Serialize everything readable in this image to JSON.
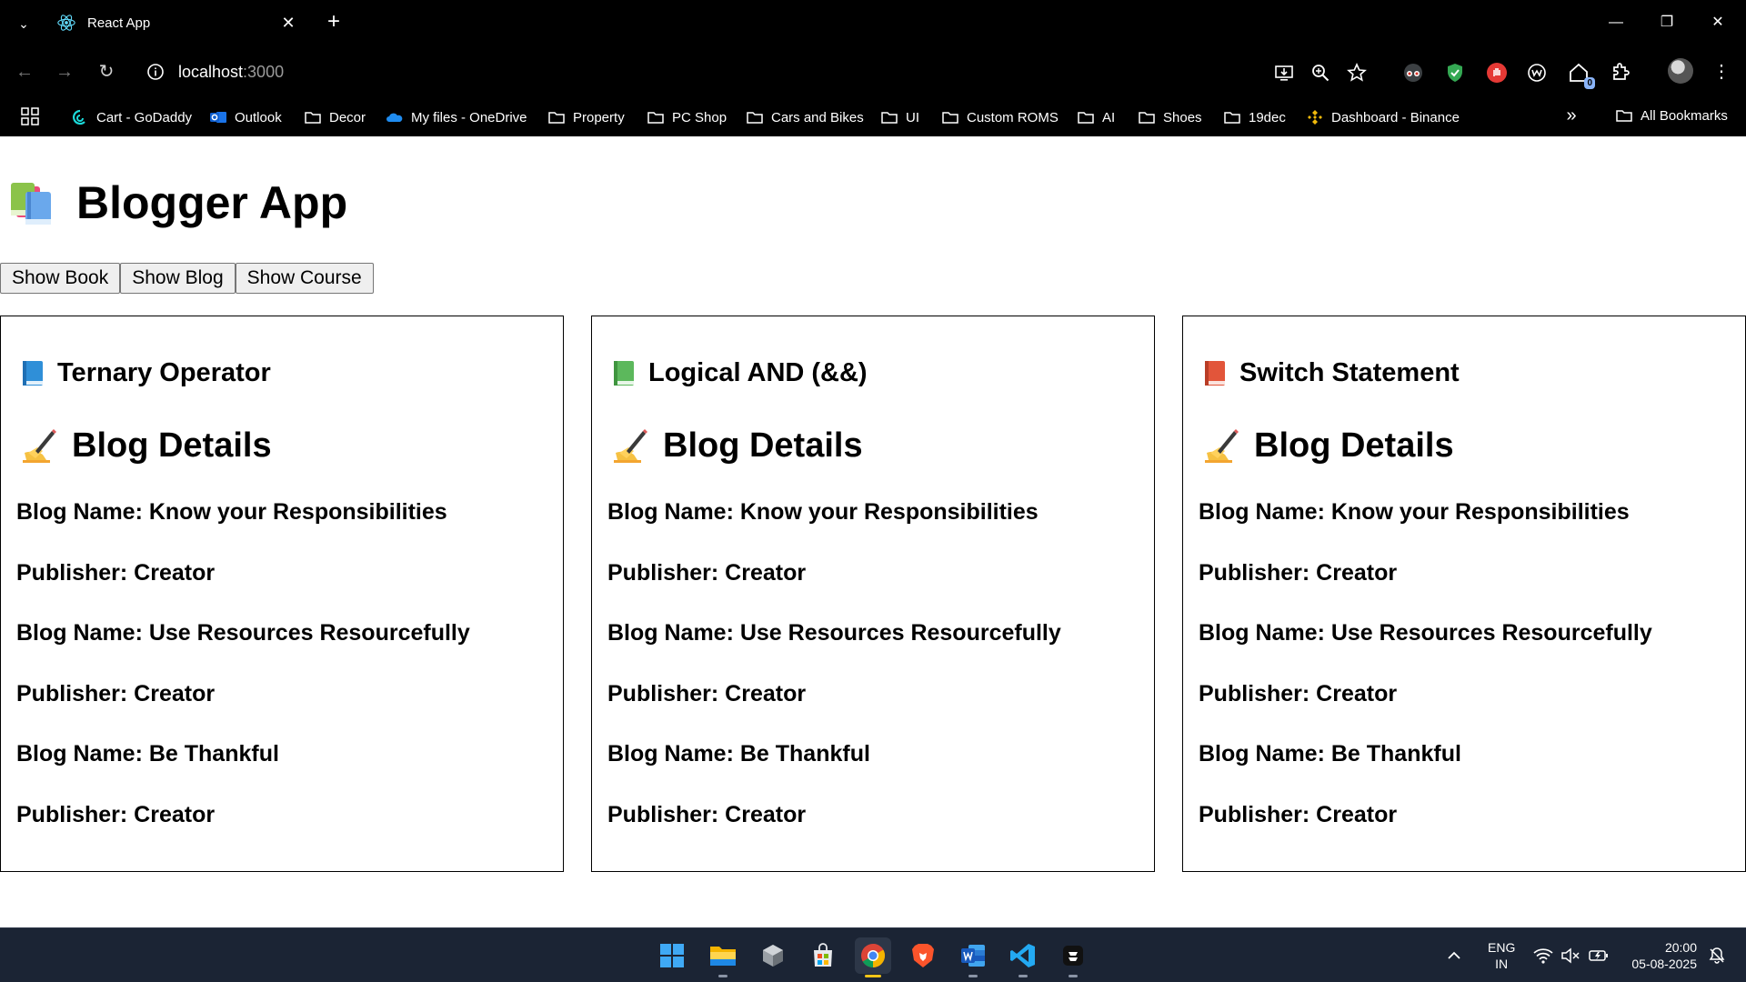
{
  "browser": {
    "tab_title": "React App",
    "url_host": "localhost",
    "url_port": ":3000",
    "extension_badge": "0"
  },
  "bookmarks": [
    {
      "label": "Cart - GoDaddy",
      "icon": "godaddy-icon"
    },
    {
      "label": "Outlook",
      "icon": "outlook-icon"
    },
    {
      "label": "Decor",
      "icon": "folder-icon"
    },
    {
      "label": "My files - OneDrive",
      "icon": "onedrive-icon"
    },
    {
      "label": "Property",
      "icon": "folder-icon"
    },
    {
      "label": "PC Shop",
      "icon": "folder-icon"
    },
    {
      "label": "Cars and Bikes",
      "icon": "folder-icon"
    },
    {
      "label": "UI",
      "icon": "folder-icon"
    },
    {
      "label": "Custom ROMS",
      "icon": "folder-icon"
    },
    {
      "label": "AI",
      "icon": "folder-icon"
    },
    {
      "label": "Shoes",
      "icon": "folder-icon"
    },
    {
      "label": "19dec",
      "icon": "folder-icon"
    },
    {
      "label": "Dashboard - Binance",
      "icon": "binance-icon"
    }
  ],
  "all_bookmarks_label": "All Bookmarks",
  "app": {
    "title": "Blogger App",
    "buttons": [
      "Show Book",
      "Show Blog",
      "Show Course"
    ],
    "cards": [
      {
        "heading": "Ternary Operator",
        "book_color": "#2f8fd8",
        "section_title": "Blog Details",
        "entries": [
          {
            "name": "Blog Name: Know your Responsibilities",
            "publisher": "Publisher: Creator"
          },
          {
            "name": "Blog Name: Use Resources Resourcefully",
            "publisher": "Publisher: Creator"
          },
          {
            "name": "Blog Name: Be Thankful",
            "publisher": "Publisher: Creator"
          }
        ]
      },
      {
        "heading": "Logical AND (&&)",
        "book_color": "#5cb85c",
        "section_title": "Blog Details",
        "entries": [
          {
            "name": "Blog Name: Know your Responsibilities",
            "publisher": "Publisher: Creator"
          },
          {
            "name": "Blog Name: Use Resources Resourcefully",
            "publisher": "Publisher: Creator"
          },
          {
            "name": "Blog Name: Be Thankful",
            "publisher": "Publisher: Creator"
          }
        ]
      },
      {
        "heading": "Switch Statement",
        "book_color": "#e2553a",
        "section_title": "Blog Details",
        "entries": [
          {
            "name": "Blog Name: Know your Responsibilities",
            "publisher": "Publisher: Creator"
          },
          {
            "name": "Blog Name: Use Resources Resourcefully",
            "publisher": "Publisher: Creator"
          },
          {
            "name": "Blog Name: Be Thankful",
            "publisher": "Publisher: Creator"
          }
        ]
      }
    ]
  },
  "taskbar": {
    "lang_line1": "ENG",
    "lang_line2": "IN",
    "time": "20:00",
    "date": "05-08-2025"
  }
}
